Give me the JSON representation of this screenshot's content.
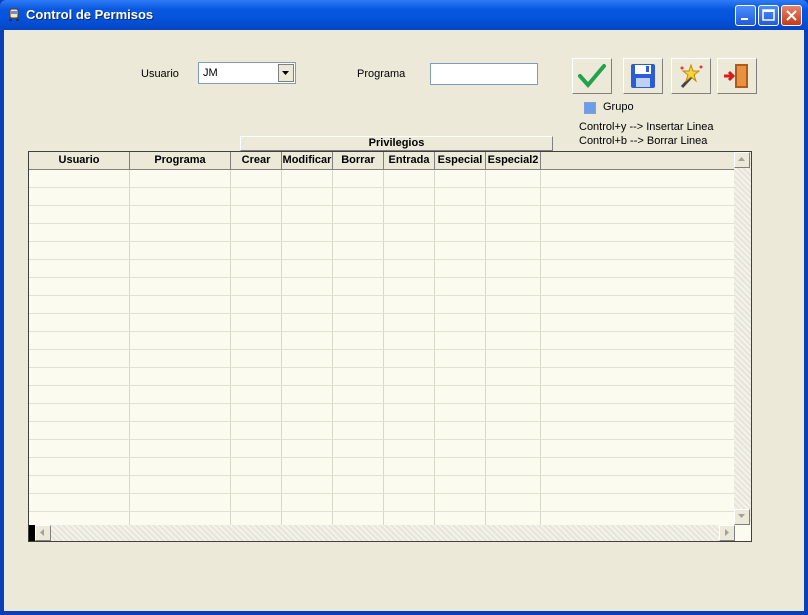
{
  "window": {
    "title": "Control de Permisos"
  },
  "filters": {
    "usuario_label": "Usuario",
    "usuario_value": "JM",
    "programa_label": "Programa",
    "programa_value": ""
  },
  "toolbar": {
    "accept": "check-icon",
    "save": "floppy-disk-icon",
    "wizard": "magic-wand-icon",
    "exit": "exit-door-icon"
  },
  "grupo_label": "Grupo",
  "hints": [
    "Control+y --> Insertar Linea",
    "Control+b --> Borrar Linea"
  ],
  "grid": {
    "group_header": "Privilegios",
    "columns": [
      "Usuario",
      "Programa",
      "Crear",
      "Modificar",
      "Borrar",
      "Entrada",
      "Especial",
      "Especial2"
    ],
    "rows": []
  }
}
